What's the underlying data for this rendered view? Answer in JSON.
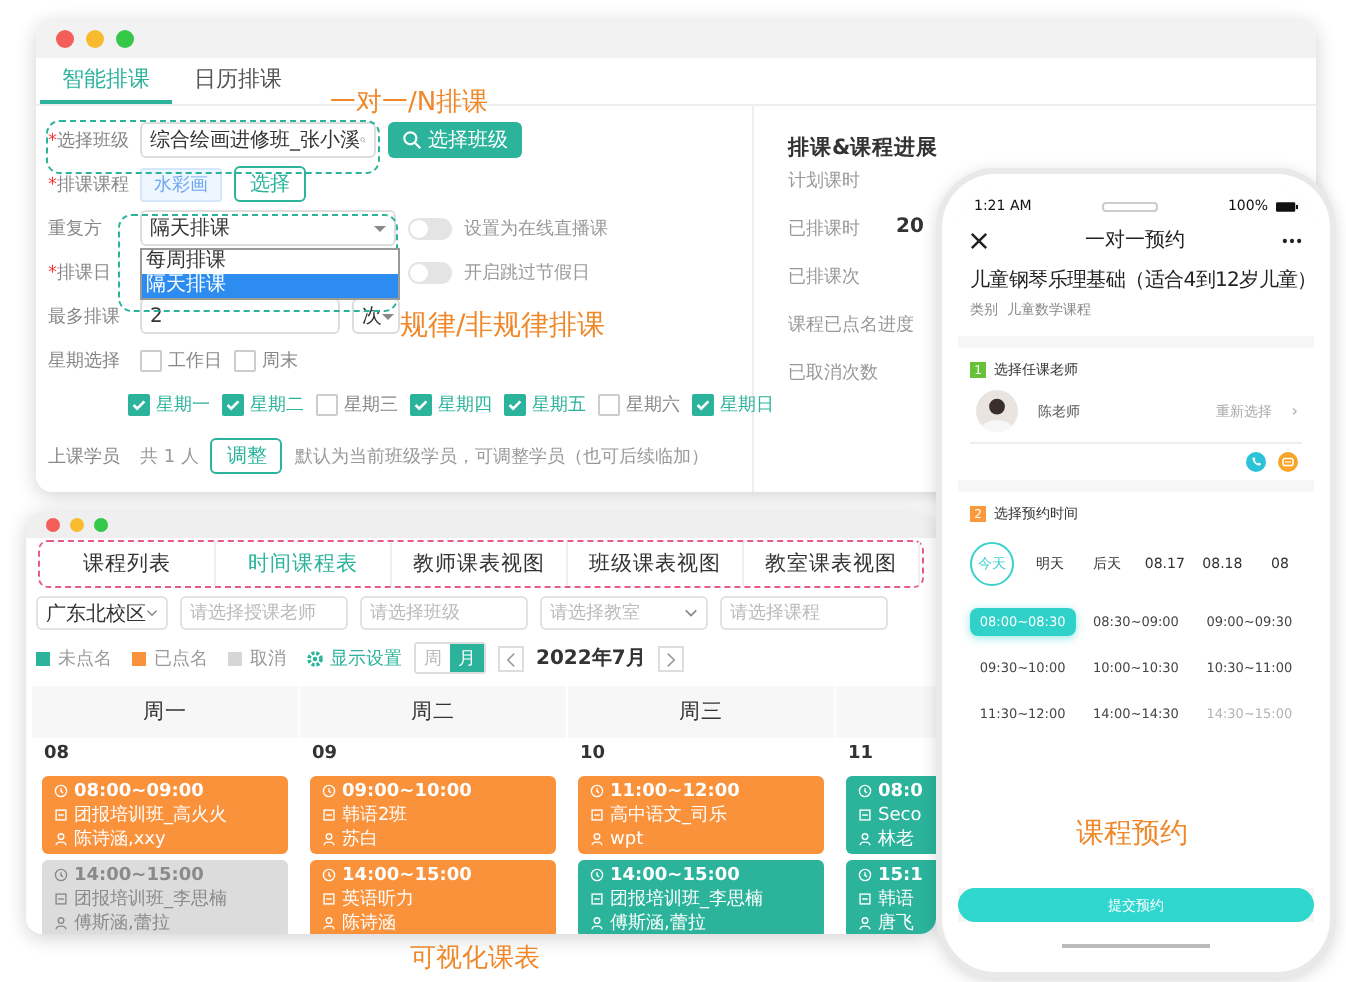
{
  "schedule_window": {
    "tabs": [
      {
        "label": "智能排课",
        "selected": true
      },
      {
        "label": "日历排课",
        "selected": false
      }
    ],
    "class_field": {
      "required": "*",
      "label": "选择班级",
      "value": "综合绘画进修班_张小溪",
      "button": "选择班级"
    },
    "course_row": {
      "required": "*",
      "label": "排课课程",
      "tag": "水彩画",
      "button": "选择"
    },
    "repeat_row": {
      "label": "重复方",
      "value": "隔天排课",
      "options": [
        {
          "label": "每周排课",
          "selected": false
        },
        {
          "label": "隔天排课",
          "selected": true
        }
      ],
      "toggle": {
        "label": "设置为在线直播课",
        "on": false
      }
    },
    "date_row": {
      "required": "*",
      "label": "排课日",
      "toggle": {
        "label": "开启跳过节假日",
        "on": false
      }
    },
    "max_row": {
      "label": "最多排课",
      "value": "2",
      "unit": "次"
    },
    "week_row": {
      "label": "星期选择",
      "quick": [
        {
          "label": "工作日",
          "checked": false
        },
        {
          "label": "周末",
          "checked": false
        }
      ],
      "days": [
        {
          "label": "星期一",
          "checked": true
        },
        {
          "label": "星期二",
          "checked": true
        },
        {
          "label": "星期三",
          "checked": false
        },
        {
          "label": "星期四",
          "checked": true
        },
        {
          "label": "星期五",
          "checked": true
        },
        {
          "label": "星期六",
          "checked": false
        },
        {
          "label": "星期日",
          "checked": true
        }
      ]
    },
    "students_row": {
      "label": "上课学员",
      "count": "共 1 人",
      "button": "调整",
      "hint": "默认为当前班级学员，可调整学员（也可后续临加）"
    },
    "progress": {
      "title": "排课&课程进展",
      "items": [
        {
          "label": "计划课时"
        },
        {
          "label": "已排课时",
          "value": "20"
        },
        {
          "label": "已排课次"
        },
        {
          "label": "课程已点名进度"
        },
        {
          "label": "已取消次数"
        }
      ]
    }
  },
  "timetable_window": {
    "tabs": [
      {
        "label": "课程列表",
        "selected": false
      },
      {
        "label": "时间课程表",
        "selected": true
      },
      {
        "label": "教师课表视图",
        "selected": false
      },
      {
        "label": "班级课表视图",
        "selected": false
      },
      {
        "label": "教室课表视图",
        "selected": false
      }
    ],
    "filters": [
      {
        "kind": "select",
        "value": "广东北校区"
      },
      {
        "kind": "input",
        "placeholder": "请选择授课老师"
      },
      {
        "kind": "input",
        "placeholder": "请选择班级"
      },
      {
        "kind": "select",
        "placeholder": "请选择教室"
      },
      {
        "kind": "input",
        "placeholder": "请选择课程"
      }
    ],
    "legend": [
      {
        "label": "未点名",
        "color": "#2bb39b"
      },
      {
        "label": "已点名",
        "color": "#fa923c"
      },
      {
        "label": "取消",
        "color": "#d6d6d6"
      }
    ],
    "display_settings": "显示设置",
    "views": [
      {
        "label": "周",
        "selected": false
      },
      {
        "label": "月",
        "selected": true
      }
    ],
    "month": "2022年7月",
    "columns": [
      {
        "day": "周一",
        "date": "08",
        "events": [
          {
            "color": "#fa923c",
            "time": "08:00~09:00",
            "course": "团报培训班_高火火",
            "people": "陈诗涵,xxy"
          },
          {
            "color": "#dcdcdc",
            "time": "14:00~15:00",
            "course": "团报培训班_李思楠",
            "people": "傅斯涵,蕾拉"
          }
        ]
      },
      {
        "day": "周二",
        "date": "09",
        "events": [
          {
            "color": "#fa923c",
            "time": "09:00~10:00",
            "course": "韩语2班",
            "people": "苏白"
          },
          {
            "color": "#fa923c",
            "time": "14:00~15:00",
            "course": "英语听力",
            "people": "陈诗涵"
          }
        ]
      },
      {
        "day": "周三",
        "date": "10",
        "events": [
          {
            "color": "#fa923c",
            "time": "11:00~12:00",
            "course": "高中语文_司乐",
            "people": "wpt"
          },
          {
            "color": "#2bb39b",
            "time": "14:00~15:00",
            "course": "团报培训班_李思楠",
            "people": "傅斯涵,蕾拉"
          }
        ]
      },
      {
        "date": "11",
        "events": [
          {
            "color": "#2bb39b",
            "time": "08:0",
            "course": "Seco",
            "people": "林老"
          },
          {
            "color": "#2bb39b",
            "time": "15:1",
            "course": "韩语",
            "people": "唐飞"
          }
        ]
      }
    ]
  },
  "phone": {
    "clock": "1:21 AM",
    "battery": "100%",
    "title": "一对一预约",
    "course": "儿童钢琴乐理基础（适合4到12岁儿童）",
    "category": "类别  儿童数学课程",
    "step1": {
      "number": "1",
      "title": "选择任课老师",
      "teacher": "陈老师",
      "change": "重新选择",
      "arrow": "›"
    },
    "step2": {
      "number": "2",
      "title": "选择预约时间"
    },
    "dates": [
      {
        "label": "今天",
        "selected": true
      },
      {
        "label": "明天",
        "selected": false
      },
      {
        "label": "后天",
        "selected": false
      },
      {
        "label": "08.17",
        "selected": false
      },
      {
        "label": "08.18",
        "selected": false
      },
      {
        "label": "08",
        "selected": false
      }
    ],
    "slots": [
      {
        "label": "08:00~08:30",
        "selected": true,
        "disabled": false
      },
      {
        "label": "08:30~09:00",
        "selected": false,
        "disabled": false
      },
      {
        "label": "09:00~09:30",
        "selected": false,
        "disabled": false
      },
      {
        "label": "09:30~10:00",
        "selected": false,
        "disabled": false
      },
      {
        "label": "10:00~10:30",
        "selected": false,
        "disabled": false
      },
      {
        "label": "10:30~11:00",
        "selected": false,
        "disabled": false
      },
      {
        "label": "11:30~12:00",
        "selected": false,
        "disabled": false
      },
      {
        "label": "14:00~14:30",
        "selected": false,
        "disabled": false
      },
      {
        "label": "14:30~15:00",
        "selected": false,
        "disabled": true
      }
    ],
    "submit": "提交预约"
  },
  "captions": [
    "一对一/N排课",
    "规律/非规律排课",
    "可视化课表",
    "课程预约"
  ]
}
